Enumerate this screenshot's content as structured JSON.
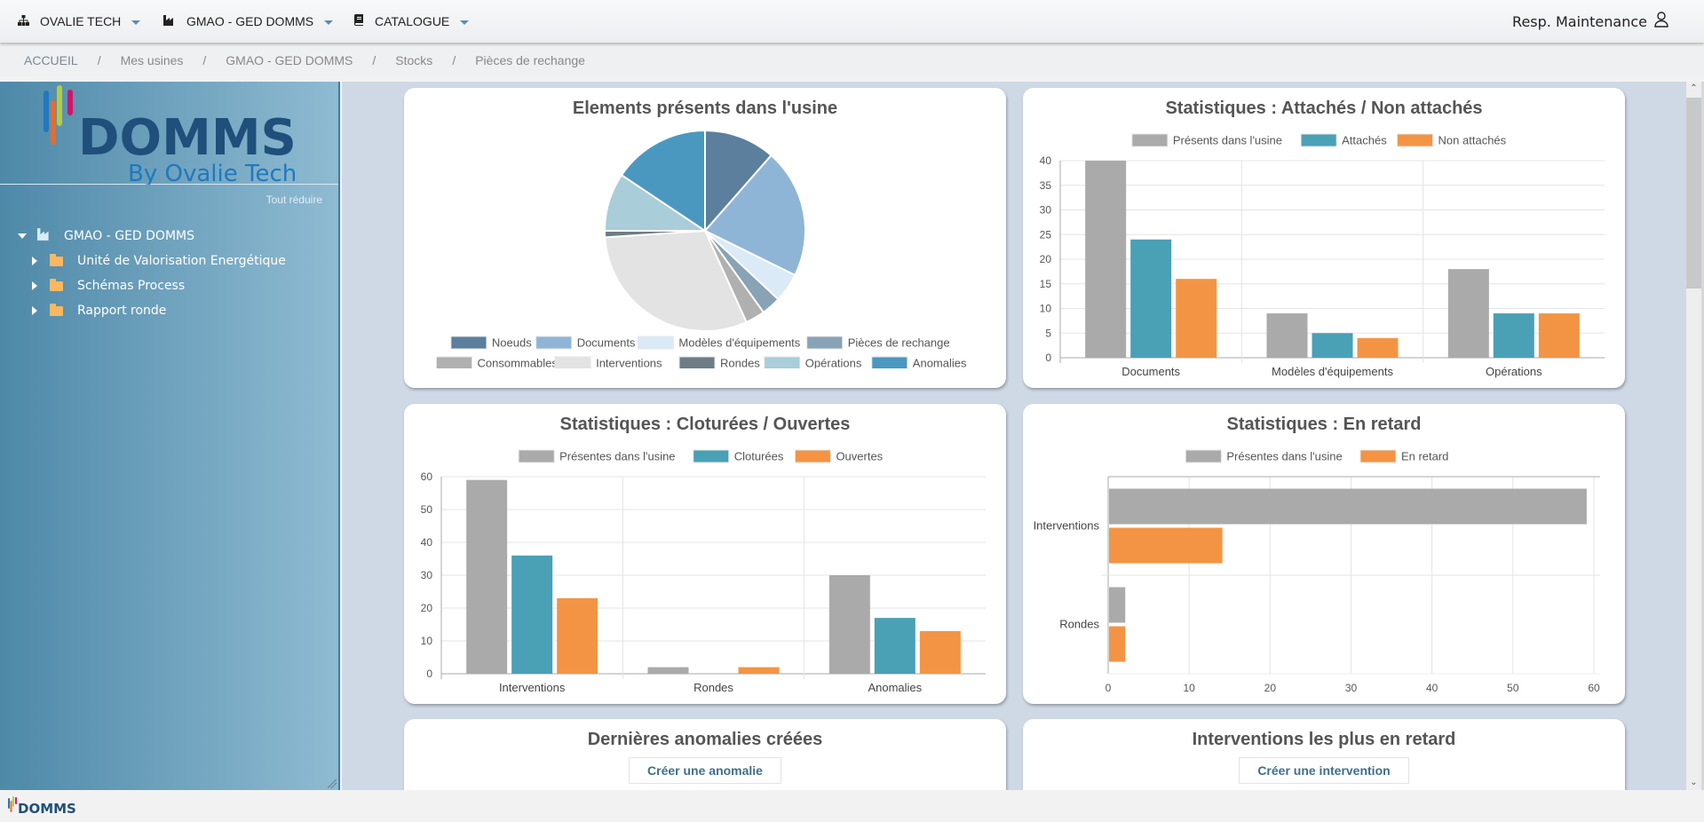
{
  "topbar": {
    "menus": [
      {
        "label": "OVALIE TECH",
        "icon": "sitemap-icon"
      },
      {
        "label": "GMAO - GED DOMMS",
        "icon": "industry-icon"
      },
      {
        "label": "CATALOGUE",
        "icon": "book-icon"
      }
    ],
    "user_label": "Resp. Maintenance",
    "user_icon": "user-icon"
  },
  "breadcrumb": [
    "ACCUEIL",
    "Mes usines",
    "GMAO - GED DOMMS",
    "Stocks",
    "Pièces de rechange"
  ],
  "sidebar": {
    "logo_text": "DOMMS",
    "logo_subtext": "By Ovalie Tech",
    "collapse_all": "Tout réduire",
    "tree_root": "GMAO - GED DOMMS",
    "tree_children": [
      "Unité de Valorisation Energétique",
      "Schémas Process",
      "Rapport ronde"
    ]
  },
  "colors": {
    "gray": "#aaaaaa",
    "teal": "#4aa0b5",
    "orange": "#f39444"
  },
  "chart_data": [
    {
      "type": "pie",
      "title": "Elements présents dans l'usine",
      "legend_position": "bottom",
      "categories": [
        "Noeuds",
        "Documents",
        "Modèles d'équipements",
        "Pièces de rechange",
        "Consommables",
        "Interventions",
        "Rondes",
        "Opérations",
        "Anomalies"
      ],
      "values": [
        22,
        40,
        9,
        6,
        6,
        59,
        2,
        18,
        30
      ],
      "colors": [
        "#5b7f9c",
        "#8fb5d6",
        "#dbeaf7",
        "#88a2b6",
        "#b0b0b0",
        "#e3e3e3",
        "#6e7c86",
        "#a9cdd9",
        "#4a98c0"
      ]
    },
    {
      "type": "bar",
      "title": "Statistiques : Attachés / Non attachés",
      "legend_position": "top",
      "categories": [
        "Documents",
        "Modèles d'équipements",
        "Opérations"
      ],
      "series": [
        {
          "name": "Présents dans l'usine",
          "values": [
            40,
            9,
            18
          ],
          "color": "#aaaaaa"
        },
        {
          "name": "Attachés",
          "values": [
            24,
            5,
            9
          ],
          "color": "#4aa0b5"
        },
        {
          "name": "Non attachés",
          "values": [
            16,
            4,
            9
          ],
          "color": "#f39444"
        }
      ],
      "ylim": [
        0,
        40
      ],
      "yticks": [
        0,
        5,
        10,
        15,
        20,
        25,
        30,
        35,
        40
      ],
      "grid": true
    },
    {
      "type": "bar",
      "title": "Statistiques : Cloturées / Ouvertes",
      "legend_position": "top",
      "categories": [
        "Interventions",
        "Rondes",
        "Anomalies"
      ],
      "series": [
        {
          "name": "Présentes dans l'usine",
          "values": [
            59,
            2,
            30
          ],
          "color": "#aaaaaa"
        },
        {
          "name": "Cloturées",
          "values": [
            36,
            0,
            17
          ],
          "color": "#4aa0b5"
        },
        {
          "name": "Ouvertes",
          "values": [
            23,
            2,
            13
          ],
          "color": "#f39444"
        }
      ],
      "ylim": [
        0,
        60
      ],
      "yticks": [
        0,
        10,
        20,
        30,
        40,
        50,
        60
      ],
      "grid": true
    },
    {
      "type": "bar",
      "orientation": "horizontal",
      "title": "Statistiques : En retard",
      "legend_position": "top",
      "categories": [
        "Interventions",
        "Rondes"
      ],
      "series": [
        {
          "name": "Présentes dans l'usine",
          "values": [
            59,
            2
          ],
          "color": "#aaaaaa"
        },
        {
          "name": "En retard",
          "values": [
            14,
            2
          ],
          "color": "#f39444"
        }
      ],
      "xlim": [
        0,
        60
      ],
      "xticks": [
        0,
        10,
        20,
        30,
        40,
        50,
        60
      ],
      "grid": true
    }
  ],
  "panels": {
    "anomalies": {
      "title": "Dernières anomalies créées",
      "button": "Créer une anomalie"
    },
    "interventions": {
      "title": "Interventions les plus en retard",
      "button": "Créer une intervention"
    }
  },
  "footer": {
    "logo_text": "DOMMS"
  }
}
